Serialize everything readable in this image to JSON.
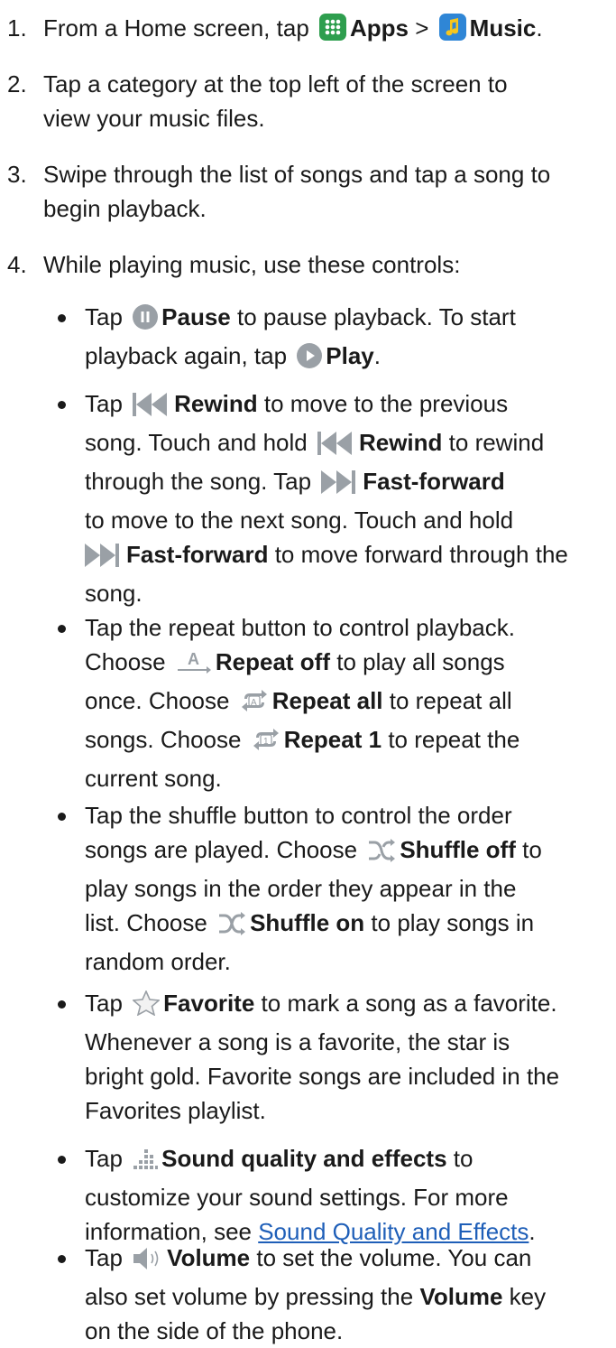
{
  "steps": [
    {
      "num": "1.",
      "pre": "From a Home screen, tap",
      "apps": "Apps",
      "sep": ">",
      "music": "Music",
      "end": "."
    },
    {
      "num": "2.",
      "l1": "Tap a category at the top left of the screen to",
      "l2": "view your music files."
    },
    {
      "num": "3.",
      "l1": "Swipe through the list of songs and tap a song to",
      "l2": "begin playback."
    },
    {
      "num": "4.",
      "l1": "While playing music, use these controls:"
    }
  ],
  "bullets": {
    "pause": {
      "t1": "Tap",
      "b1": "Pause",
      "t2": "to pause playback. To start",
      "t3": "playback again, tap",
      "b2": "Play",
      "t4": "."
    },
    "rewind": {
      "t1": "Tap",
      "b1": "Rewind",
      "t2": "to move to the previous",
      "t3": "song. Touch and hold",
      "b2": "Rewind",
      "t4": "to rewind",
      "t5": "through the song. Tap",
      "b3": "Fast-forward",
      "t6": "to move to the next song. Touch and hold",
      "b4": "Fast-forward",
      "t7": "to move forward through the",
      "t8": "song."
    },
    "repeat": {
      "t1": "Tap the repeat button to control playback.",
      "t2": "Choose",
      "b1": "Repeat off",
      "t3": "to play all songs",
      "t4": "once. Choose",
      "b2": "Repeat all",
      "t5": "to repeat all",
      "t6": "songs. Choose",
      "b3": "Repeat 1",
      "t7": "to repeat the",
      "t8": "current song."
    },
    "shuffle": {
      "t1": "Tap the shuffle button to control the order",
      "t2": "songs are played. Choose",
      "b1": "Shuffle off",
      "t3": "to",
      "t4": "play songs in the order they appear in the",
      "t5": "list. Choose",
      "b2": "Shuffle on",
      "t6": "to play songs in",
      "t7": "random order."
    },
    "favorite": {
      "t1": "Tap",
      "b1": "Favorite",
      "t2": "to mark a song as a favorite.",
      "t3": "Whenever a song is a favorite, the star is",
      "t4": "bright gold. Favorite songs are included in the",
      "t5": "Favorites playlist."
    },
    "sound": {
      "t1": "Tap",
      "b1": "Sound quality and effects",
      "t2": "to",
      "t3": "customize your sound settings. For more",
      "t4": "information, see",
      "link": "Sound Quality and Effects",
      "t5": "."
    },
    "volume": {
      "t1": "Tap",
      "b1": "Volume",
      "t2": "to set the volume. You can",
      "t3": "also set volume by pressing the",
      "b2": "Volume",
      "t4": "key",
      "t5": "on the side of the phone."
    }
  },
  "icon_names": [
    "apps-icon",
    "music-icon",
    "pause-icon",
    "play-icon",
    "rewind-icon",
    "fast-forward-icon",
    "repeat-off-icon",
    "repeat-all-icon",
    "repeat-1-icon",
    "shuffle-off-icon",
    "shuffle-on-icon",
    "favorite-star-icon",
    "sound-effects-icon",
    "volume-icon"
  ],
  "icon_glyphs": {
    "repeat_off": "A",
    "repeat_all": "A",
    "repeat_1": "1"
  },
  "colors": {
    "text": "#1a1a1a",
    "link": "#1f5fb8",
    "apps_icon": "#2e9e4e",
    "music_icon": "#2f86d6",
    "control_icon": "#9aa0a6"
  }
}
